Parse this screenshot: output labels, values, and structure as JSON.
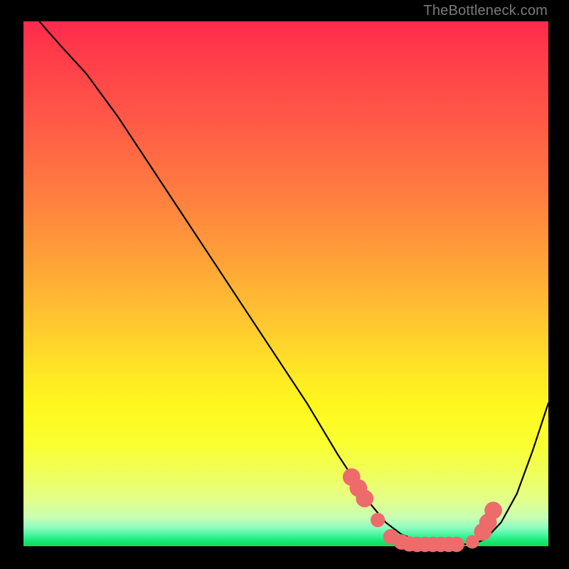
{
  "watermark": "TheBottleneck.com",
  "chart_data": {
    "type": "line",
    "title": "",
    "xlabel": "",
    "ylabel": "",
    "xlim": [
      0,
      100
    ],
    "ylim": [
      0,
      110
    ],
    "grid": false,
    "legend": false,
    "series": [
      {
        "name": "curve",
        "x": [
          3,
          7,
          12,
          18,
          24,
          30,
          36,
          42,
          48,
          54,
          60,
          63,
          66,
          69,
          72,
          75,
          78,
          81,
          84,
          86,
          88,
          91,
          94,
          97,
          100
        ],
        "y": [
          110,
          105,
          99,
          90,
          80,
          70,
          60,
          50,
          40,
          30,
          19,
          14,
          9,
          5,
          2.5,
          1.2,
          0.6,
          0.4,
          0.4,
          0.6,
          1.5,
          5,
          11,
          20,
          30
        ]
      }
    ],
    "markers": [
      {
        "x": 62.5,
        "y": 14.5,
        "r": 1.2
      },
      {
        "x": 63.8,
        "y": 12.2,
        "r": 1.2
      },
      {
        "x": 65.0,
        "y": 10.0,
        "r": 1.2
      },
      {
        "x": 67.5,
        "y": 5.5,
        "r": 0.9
      },
      {
        "x": 70.0,
        "y": 2.0,
        "r": 1.0
      },
      {
        "x": 72.0,
        "y": 0.9,
        "r": 1.0
      },
      {
        "x": 73.5,
        "y": 0.5,
        "r": 1.0
      },
      {
        "x": 75.0,
        "y": 0.4,
        "r": 1.0
      },
      {
        "x": 76.5,
        "y": 0.4,
        "r": 1.0
      },
      {
        "x": 78.0,
        "y": 0.4,
        "r": 1.0
      },
      {
        "x": 79.5,
        "y": 0.4,
        "r": 1.0
      },
      {
        "x": 81.0,
        "y": 0.4,
        "r": 1.0
      },
      {
        "x": 82.5,
        "y": 0.4,
        "r": 1.0
      },
      {
        "x": 85.5,
        "y": 0.9,
        "r": 0.8
      },
      {
        "x": 87.5,
        "y": 3.0,
        "r": 1.2
      },
      {
        "x": 88.5,
        "y": 5.0,
        "r": 1.2
      },
      {
        "x": 89.5,
        "y": 7.5,
        "r": 1.2
      }
    ]
  }
}
